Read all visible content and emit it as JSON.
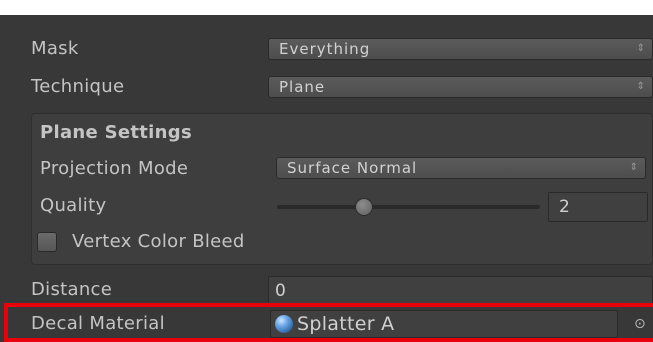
{
  "inspector": {
    "mask": {
      "label": "Mask",
      "value": "Everything"
    },
    "technique": {
      "label": "Technique",
      "value": "Plane"
    },
    "plane_settings": {
      "heading": "Plane Settings",
      "projection_mode": {
        "label": "Projection Mode",
        "value": "Surface Normal"
      },
      "quality": {
        "label": "Quality",
        "value": "2",
        "slider_fraction": 0.3
      },
      "vertex_color_bleed": {
        "label": "Vertex Color Bleed",
        "checked": false
      }
    },
    "distance": {
      "label": "Distance",
      "value": "0"
    },
    "decal_material": {
      "label": "Decal Material",
      "value": "Splatter A",
      "icon": "material-sphere-icon",
      "picker_icon": "object-picker-icon"
    }
  },
  "dropdown_arrow_glyph": "⇕",
  "picker_glyph": "⊙",
  "colors": {
    "background": "#383838",
    "text": "#c4c4c4",
    "highlight": "#e8000b"
  }
}
